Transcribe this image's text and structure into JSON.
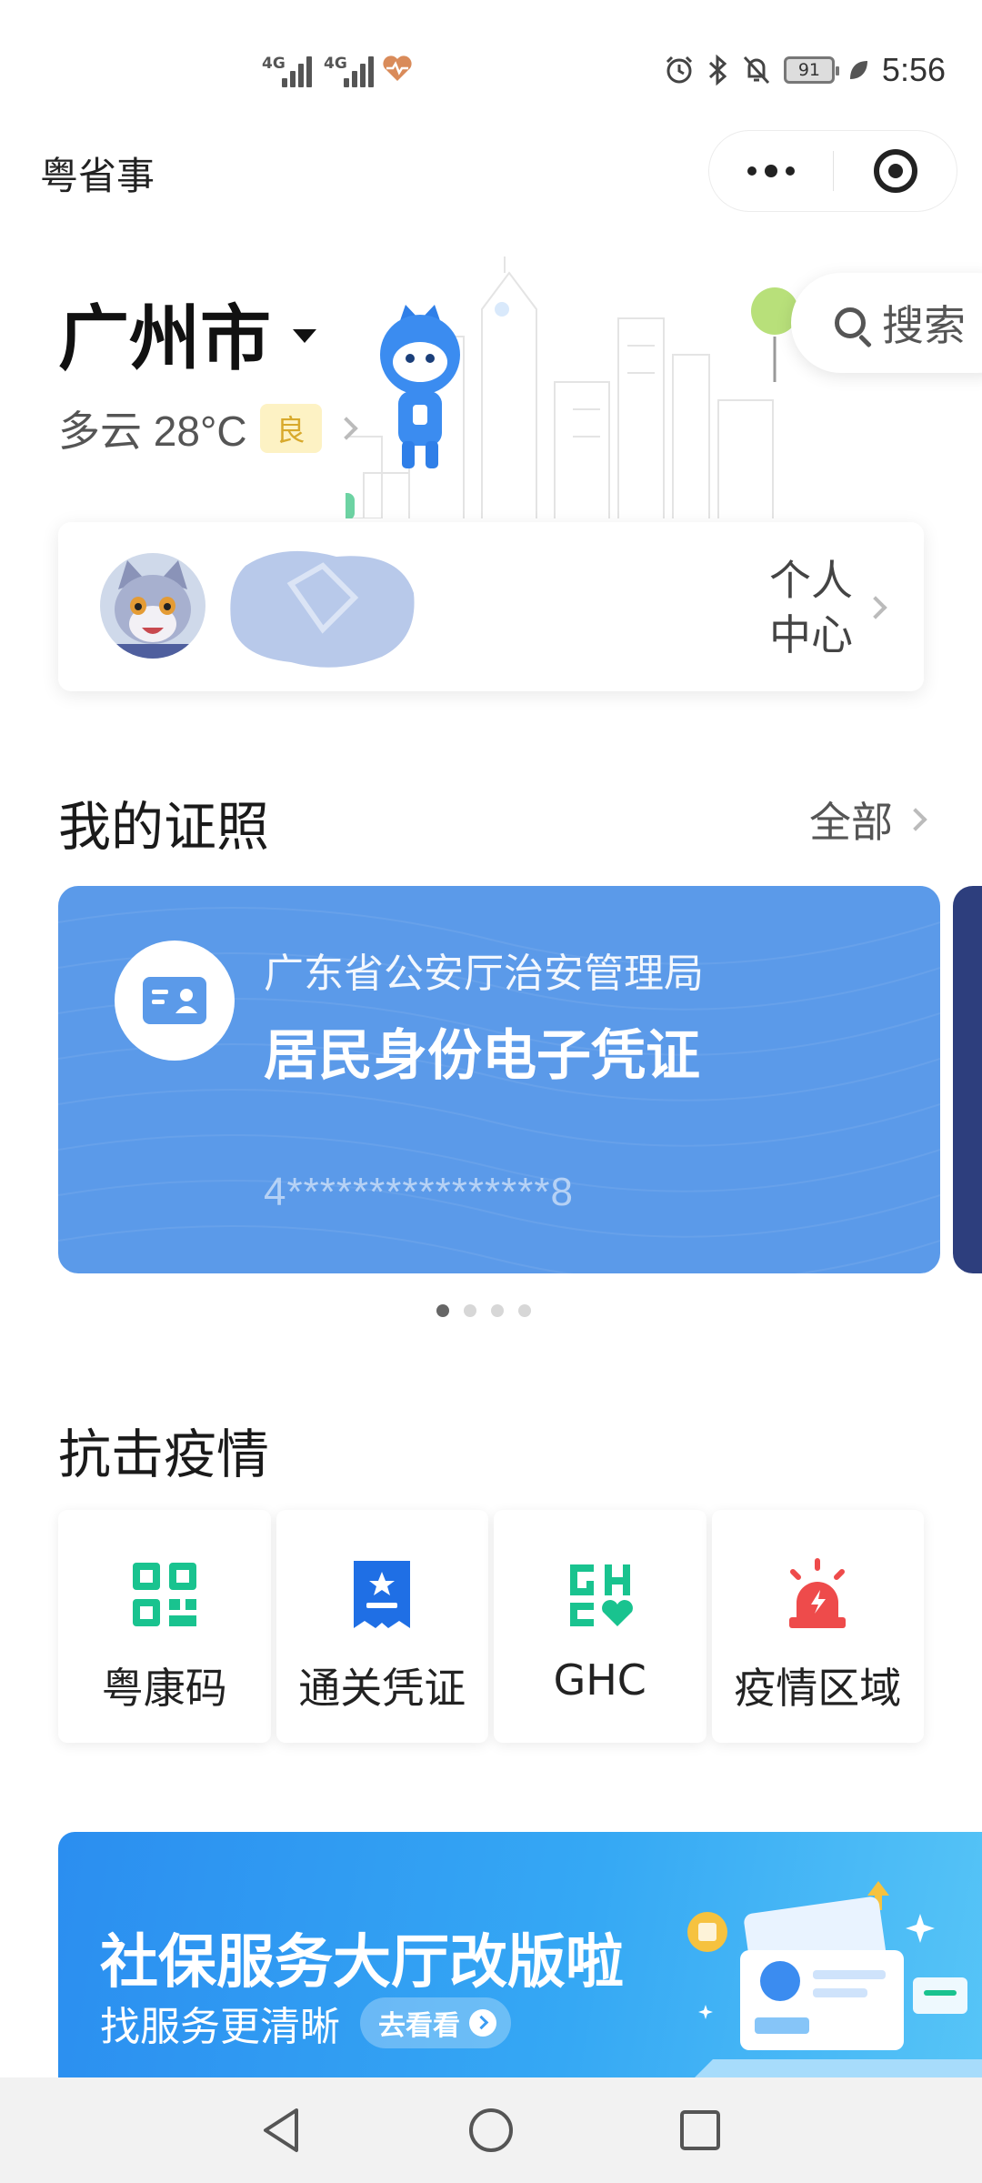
{
  "status_bar": {
    "network_1": "4G",
    "network_2": "4G",
    "battery": "91",
    "time": "5:56"
  },
  "mini_program": {
    "title": "粤省事"
  },
  "header": {
    "city": "广州市",
    "weather": "多云 28°C",
    "air_quality": "良",
    "search_label": "搜索"
  },
  "user_card": {
    "personal_center": "个人中心"
  },
  "licenses": {
    "section_title": "我的证照",
    "see_all": "全部",
    "card": {
      "issuer": "广东省公安厅治安管理局",
      "name": "居民身份电子凭证",
      "number": "4****************8"
    },
    "page_count": 4,
    "active_page": 1
  },
  "epidemic": {
    "section_title": "抗击疫情",
    "tiles": [
      {
        "label": "粤康码",
        "icon": "qr-code-icon"
      },
      {
        "label": "通关凭证",
        "icon": "pass-ticket-icon"
      },
      {
        "label": "GHC",
        "icon": "ghc-health-icon"
      },
      {
        "label": "疫情区域",
        "icon": "alarm-light-icon"
      }
    ]
  },
  "banner": {
    "title": "社保服务大厅改版啦",
    "subtitle": "找服务更清晰",
    "button": "去看看"
  },
  "colors": {
    "card_blue": "#5b9ae9",
    "epidemic_green": "#19c38f",
    "pass_blue": "#1f6fe5",
    "alarm_red": "#ee4b4b",
    "aqi_yellow": "#fdf2c4",
    "banner_blue": "#2b8ef0"
  }
}
